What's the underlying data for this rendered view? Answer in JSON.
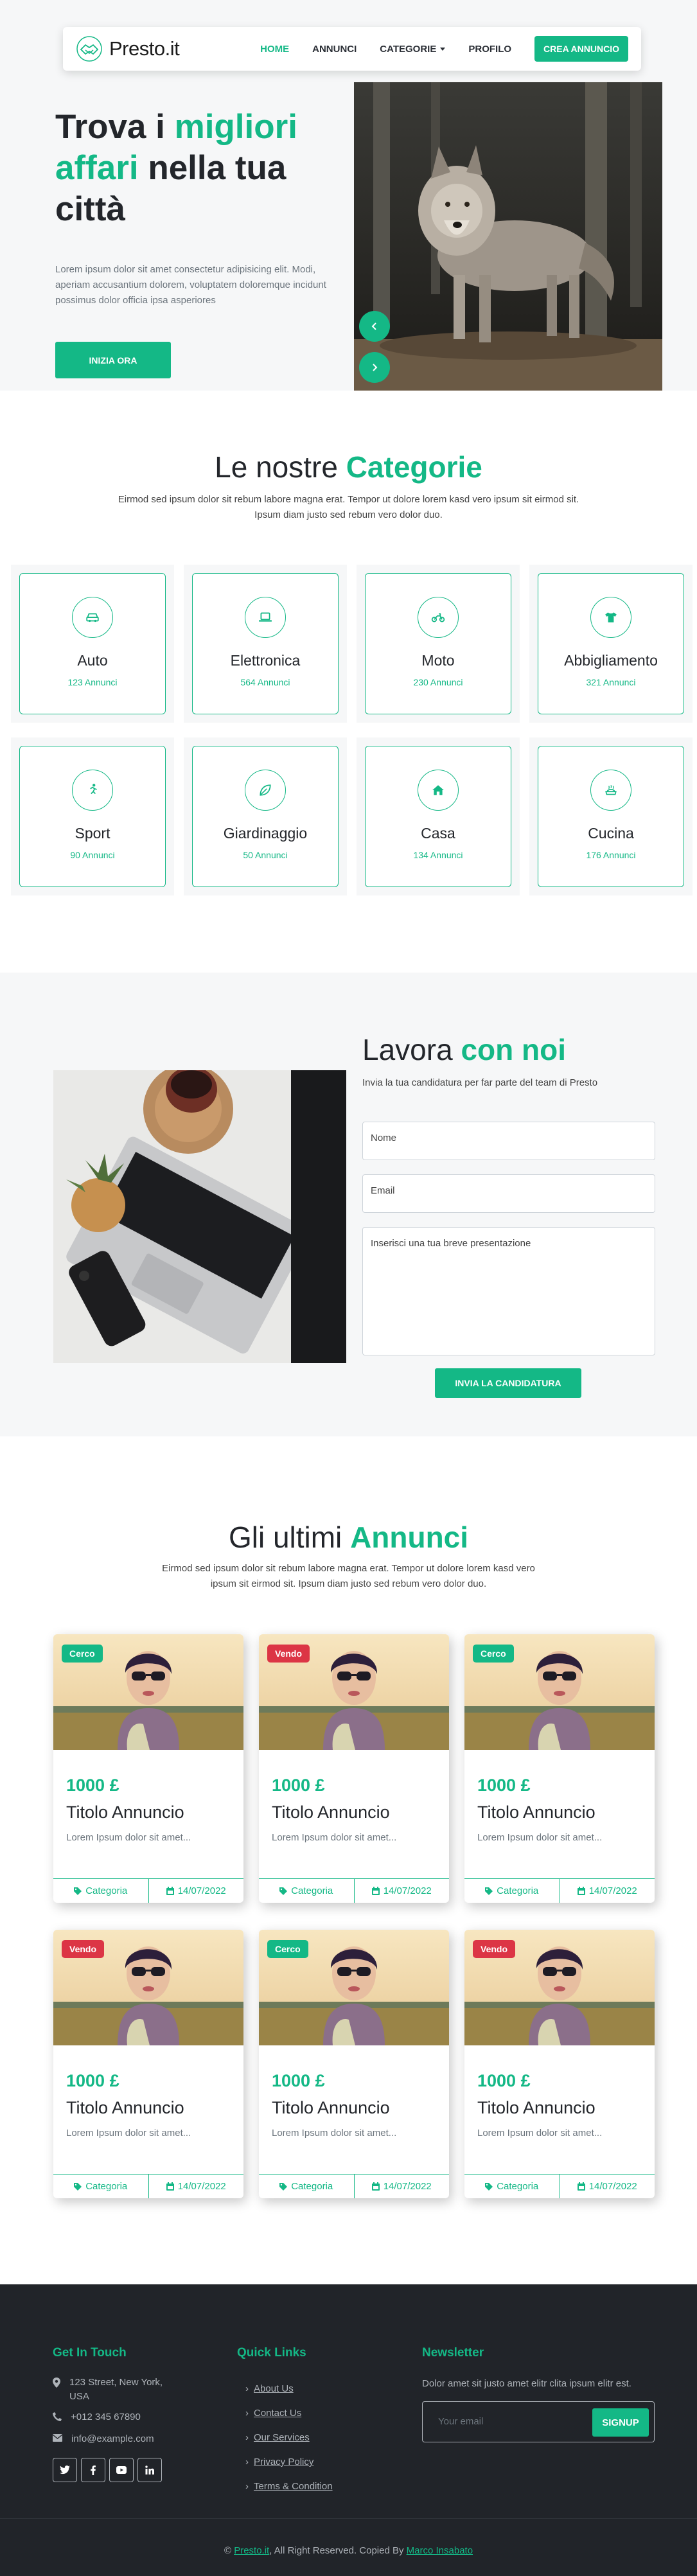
{
  "colors": {
    "accent": "#14b886",
    "sell": "#dc3545",
    "dark": "#212429",
    "light_bg": "#f6f7f8"
  },
  "navbar": {
    "brand": "Presto.it",
    "links": [
      "HOME",
      "ANNUNCI",
      "CATEGORIE",
      "PROFILO"
    ],
    "active_index": 0,
    "cta": "CREA ANNUNCIO"
  },
  "hero": {
    "title_part1": "Trova i ",
    "title_highlight": "migliori affari",
    "title_part2": " nella tua città",
    "text": "Lorem ipsum dolor sit amet consectetur adipisicing elit. Modi, aperiam accusantium dolorem, voluptatem doloremque incidunt possimus dolor officia ipsa asperiores",
    "button": "INIZIA ORA"
  },
  "categories": {
    "title_part1": "Le nostre ",
    "title_highlight": "Categorie",
    "subtitle": "Eirmod sed ipsum dolor sit rebum labore magna erat. Tempor ut dolore lorem kasd vero ipsum sit eirmod sit. Ipsum diam justo sed rebum vero dolor duo.",
    "items": [
      {
        "name": "Auto",
        "count": "123 Annunci",
        "icon": "car-icon"
      },
      {
        "name": "Elettronica",
        "count": "564 Annunci",
        "icon": "laptop-icon"
      },
      {
        "name": "Moto",
        "count": "230 Annunci",
        "icon": "motorcycle-icon"
      },
      {
        "name": "Abbigliamento",
        "count": "321 Annunci",
        "icon": "tshirt-icon"
      },
      {
        "name": "Sport",
        "count": "90 Annunci",
        "icon": "running-icon"
      },
      {
        "name": "Giardinaggio",
        "count": "50 Annunci",
        "icon": "leaf-icon"
      },
      {
        "name": "Casa",
        "count": "134 Annunci",
        "icon": "home-icon"
      },
      {
        "name": "Cucina",
        "count": "176 Annunci",
        "icon": "cooking-icon"
      }
    ]
  },
  "work": {
    "title_part1": "Lavora ",
    "title_highlight": "con noi",
    "subtitle": "Invia la tua candidatura per far parte del team di Presto",
    "name_placeholder": "Nome",
    "email_placeholder": "Email",
    "message_placeholder": "Inserisci una tua breve presentazione",
    "submit": "INVIA LA CANDIDATURA"
  },
  "listings": {
    "title_part1": "Gli ultimi ",
    "title_highlight": "Annunci",
    "subtitle": "Eirmod sed ipsum dolor sit rebum labore magna erat. Tempor ut dolore lorem kasd vero ipsum sit eirmod sit. Ipsum diam justo sed rebum vero dolor duo.",
    "items": [
      {
        "badge": "Cerco",
        "type": "buy",
        "price": "1000 £",
        "title": "Titolo Annuncio",
        "desc": "Lorem Ipsum dolor sit amet...",
        "category": "Categoria",
        "date": "14/07/2022"
      },
      {
        "badge": "Vendo",
        "type": "sell",
        "price": "1000 £",
        "title": "Titolo Annuncio",
        "desc": "Lorem Ipsum dolor sit amet...",
        "category": "Categoria",
        "date": "14/07/2022"
      },
      {
        "badge": "Cerco",
        "type": "buy",
        "price": "1000 £",
        "title": "Titolo Annuncio",
        "desc": "Lorem Ipsum dolor sit amet...",
        "category": "Categoria",
        "date": "14/07/2022"
      },
      {
        "badge": "Vendo",
        "type": "sell",
        "price": "1000 £",
        "title": "Titolo Annuncio",
        "desc": "Lorem Ipsum dolor sit amet...",
        "category": "Categoria",
        "date": "14/07/2022"
      },
      {
        "badge": "Cerco",
        "type": "buy",
        "price": "1000 £",
        "title": "Titolo Annuncio",
        "desc": "Lorem Ipsum dolor sit amet...",
        "category": "Categoria",
        "date": "14/07/2022"
      },
      {
        "badge": "Vendo",
        "type": "sell",
        "price": "1000 £",
        "title": "Titolo Annuncio",
        "desc": "Lorem Ipsum dolor sit amet...",
        "category": "Categoria",
        "date": "14/07/2022"
      }
    ]
  },
  "footer": {
    "contact_title": "Get In Touch",
    "address": "123 Street, New York, USA",
    "phone": "+012 345 67890",
    "email": "info@example.com",
    "social": [
      "twitter-icon",
      "facebook-icon",
      "youtube-icon",
      "linkedin-icon"
    ],
    "links_title": "Quick Links",
    "links": [
      "About Us",
      "Contact Us",
      "Our Services",
      "Privacy Policy",
      "Terms & Condition"
    ],
    "newsletter_title": "Newsletter",
    "newsletter_text": "Dolor amet sit justo amet elitr clita ipsum elitr est.",
    "newsletter_placeholder": "Your email",
    "newsletter_button": "SIGNUP",
    "copyright_brand": "Presto.it",
    "copyright_text": ", All Right Reserved. Copied By ",
    "copyright_author": "Marco Insabato"
  }
}
